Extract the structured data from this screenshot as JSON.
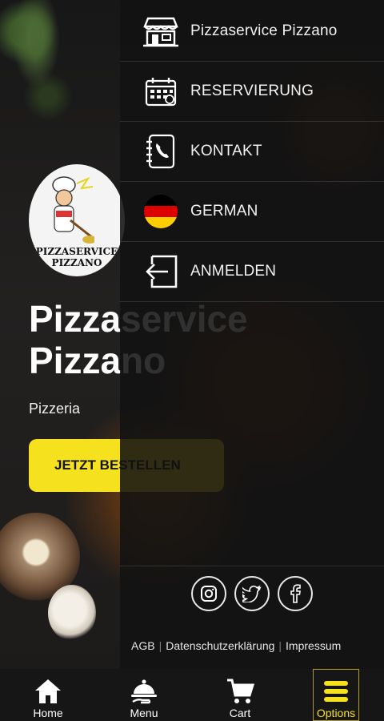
{
  "background": {
    "logo_text_line1": "PIZZASERVICE",
    "logo_text_line2": "PIZZANO",
    "hero_title_line1": "Pizzaservice",
    "hero_title_line2": "Pizzano",
    "hero_subtitle": "Pizzeria",
    "cta_label": "JETZT BESTELLEN"
  },
  "drawer": {
    "items": [
      {
        "label": "Pizzaservice Pizzano",
        "icon": "storefront-icon"
      },
      {
        "label": "RESERVIERUNG",
        "icon": "calendar-icon"
      },
      {
        "label": "KONTAKT",
        "icon": "contact-book-icon"
      },
      {
        "label": "GERMAN",
        "icon": "german-flag-icon"
      },
      {
        "label": "ANMELDEN",
        "icon": "login-icon"
      }
    ],
    "social": [
      "instagram-icon",
      "twitter-icon",
      "facebook-icon"
    ],
    "links": [
      "AGB",
      "Datenschutzerklärung",
      "Impressum"
    ]
  },
  "bottom_nav": {
    "items": [
      {
        "label": "Home",
        "icon": "home-icon"
      },
      {
        "label": "Menu",
        "icon": "cloche-icon"
      },
      {
        "label": "Cart",
        "icon": "cart-icon"
      },
      {
        "label": "Options",
        "icon": "hamburger-icon"
      }
    ],
    "active": "Options"
  },
  "colors": {
    "accent_yellow": "#f6e11e",
    "drawer_bg": "#161616",
    "flag_black": "#000000",
    "flag_red": "#dd0000",
    "flag_gold": "#ffce00"
  }
}
